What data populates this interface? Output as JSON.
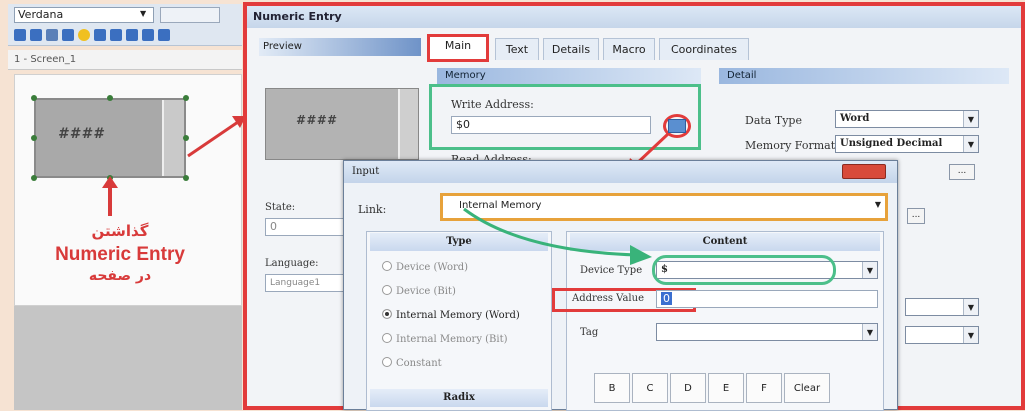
{
  "editor": {
    "font_combo": "Verdana",
    "screen_tab": "1 - Screen_1",
    "widget_text": "####",
    "annotation": {
      "line1": "گذاشتن",
      "line2": "Numeric Entry",
      "line3": "در صفحه"
    }
  },
  "dialog": {
    "title": "Numeric Entry",
    "preview_label": "Preview",
    "preview_hashes": "####",
    "tabs": [
      {
        "label": "Main"
      },
      {
        "label": "Text"
      },
      {
        "label": "Details"
      },
      {
        "label": "Macro"
      },
      {
        "label": "Coordinates"
      }
    ],
    "state_label": "State:",
    "state_value": "0",
    "language_label": "Language:",
    "language_value": "Language1",
    "memory": {
      "header": "Memory",
      "write_address_label": "Write Address:",
      "write_address_value": "$0",
      "read_address_label": "Read Address:"
    },
    "detail": {
      "header": "Detail",
      "data_type_label": "Data Type",
      "data_type_value": "Word",
      "memory_format_label": "Memory Format",
      "memory_format_value": "Unsigned Decimal"
    }
  },
  "input_dialog": {
    "title": "Input",
    "link_label": "Link:",
    "link_value": "Internal Memory",
    "type_header": "Type",
    "type_options": [
      {
        "label": "Device (Word)",
        "selected": false
      },
      {
        "label": "Device (Bit)",
        "selected": false
      },
      {
        "label": "Internal Memory (Word)",
        "selected": true
      },
      {
        "label": "Internal Memory (Bit)",
        "selected": false
      },
      {
        "label": "Constant",
        "selected": false
      }
    ],
    "radix_header": "Radix",
    "content_header": "Content",
    "device_type_label": "Device Type",
    "device_type_value": "$",
    "address_value_label": "Address Value",
    "address_value": "0",
    "tag_label": "Tag",
    "keys": [
      "B",
      "C",
      "D",
      "E",
      "F",
      "Clear"
    ]
  }
}
